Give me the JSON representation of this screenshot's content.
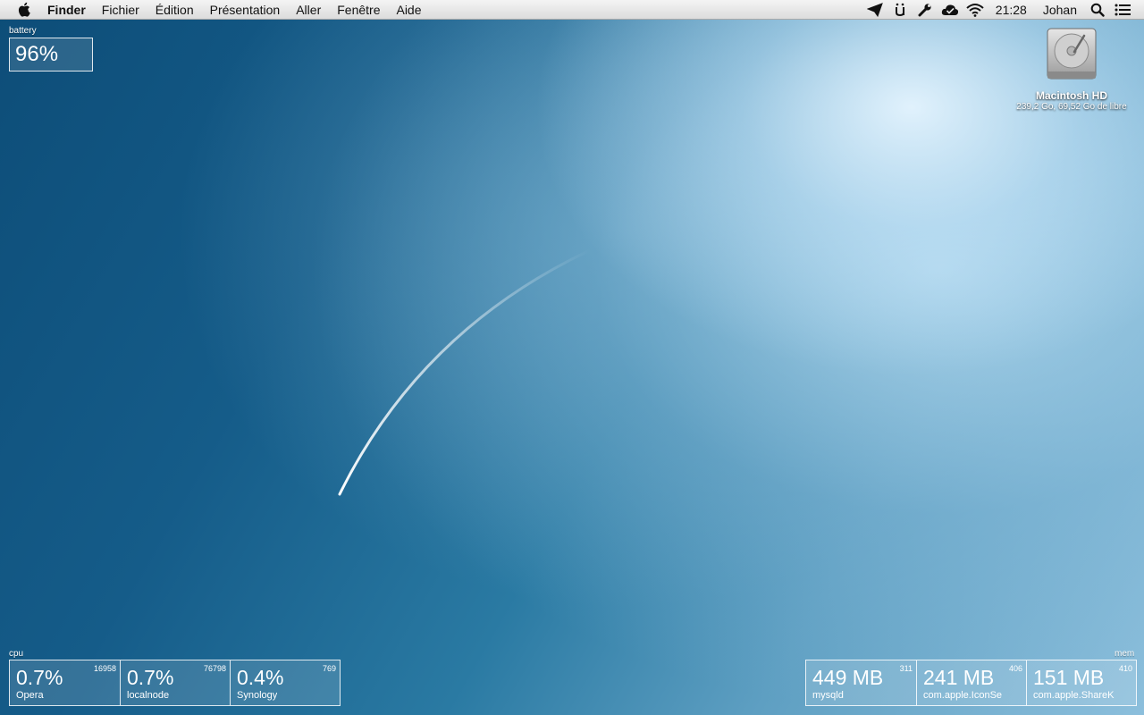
{
  "menubar": {
    "app_name": "Finder",
    "menus": [
      "Fichier",
      "Édition",
      "Présentation",
      "Aller",
      "Fenêtre",
      "Aide"
    ],
    "clock": "21:28",
    "user": "Johan",
    "status_icons": [
      "send-icon",
      "u-umlaut-icon",
      "wrench-icon",
      "cloud-check-icon",
      "wifi-icon"
    ]
  },
  "desktop": {
    "hd_name": "Macintosh HD",
    "hd_info": "239,2 Go, 69,52 Go de libre"
  },
  "battery": {
    "label": "battery",
    "value": "96%"
  },
  "cpu": {
    "label": "cpu",
    "processes": [
      {
        "value": "0.7%",
        "pid": "16958",
        "name": "Opera"
      },
      {
        "value": "0.7%",
        "pid": "76798",
        "name": "localnode"
      },
      {
        "value": "0.4%",
        "pid": "769",
        "name": "Synology"
      }
    ]
  },
  "mem": {
    "label": "mem",
    "processes": [
      {
        "value": "449 MB",
        "pid": "311",
        "name": "mysqld"
      },
      {
        "value": "241 MB",
        "pid": "406",
        "name": "com.apple.IconSe"
      },
      {
        "value": "151 MB",
        "pid": "410",
        "name": "com.apple.ShareK"
      }
    ]
  }
}
